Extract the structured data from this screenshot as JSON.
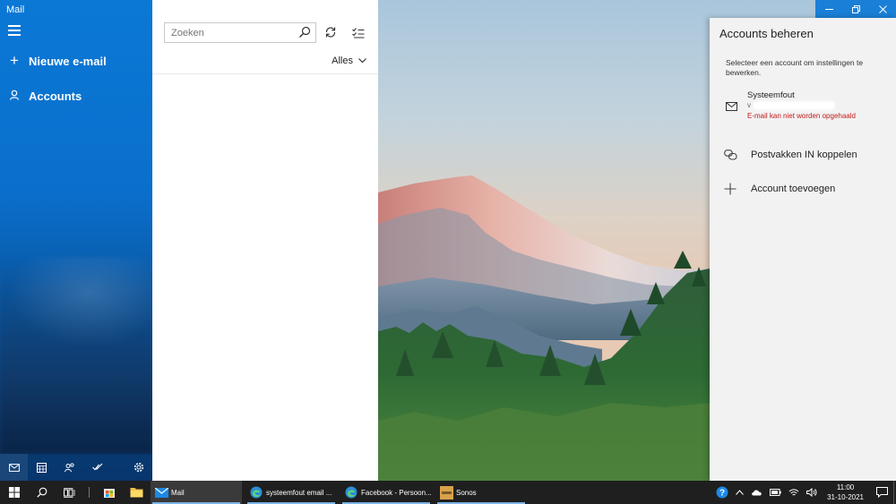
{
  "app": {
    "title": "Mail"
  },
  "nav": {
    "new_mail": "Nieuwe e-mail",
    "accounts": "Accounts"
  },
  "list": {
    "search_placeholder": "Zoeken",
    "filter": "Alles"
  },
  "flyout": {
    "title": "Accounts beheren",
    "description": "Selecteer een account om instellingen te bewerken.",
    "account": {
      "name": "Systeemfout",
      "email_visible": "v",
      "error": "E-mail kan niet worden opgehaald"
    },
    "link_inboxes": "Postvakken IN koppelen",
    "add_account": "Account toevoegen"
  },
  "taskbar": {
    "apps": [
      {
        "label": "Mail",
        "icon": "mail-icon"
      },
      {
        "label": "systeemfout email ...",
        "icon": "edge-icon"
      },
      {
        "label": "Facebook - Persoon...",
        "icon": "edge-icon"
      },
      {
        "label": "Sonos",
        "icon": "sonos-icon"
      }
    ],
    "time": "11:00",
    "date": "31-10-2021"
  },
  "colors": {
    "accent": "#0b78d6",
    "error": "#c41b1b",
    "taskbar": "#1f1f1f",
    "flyout_bg": "#f2f2f2"
  }
}
